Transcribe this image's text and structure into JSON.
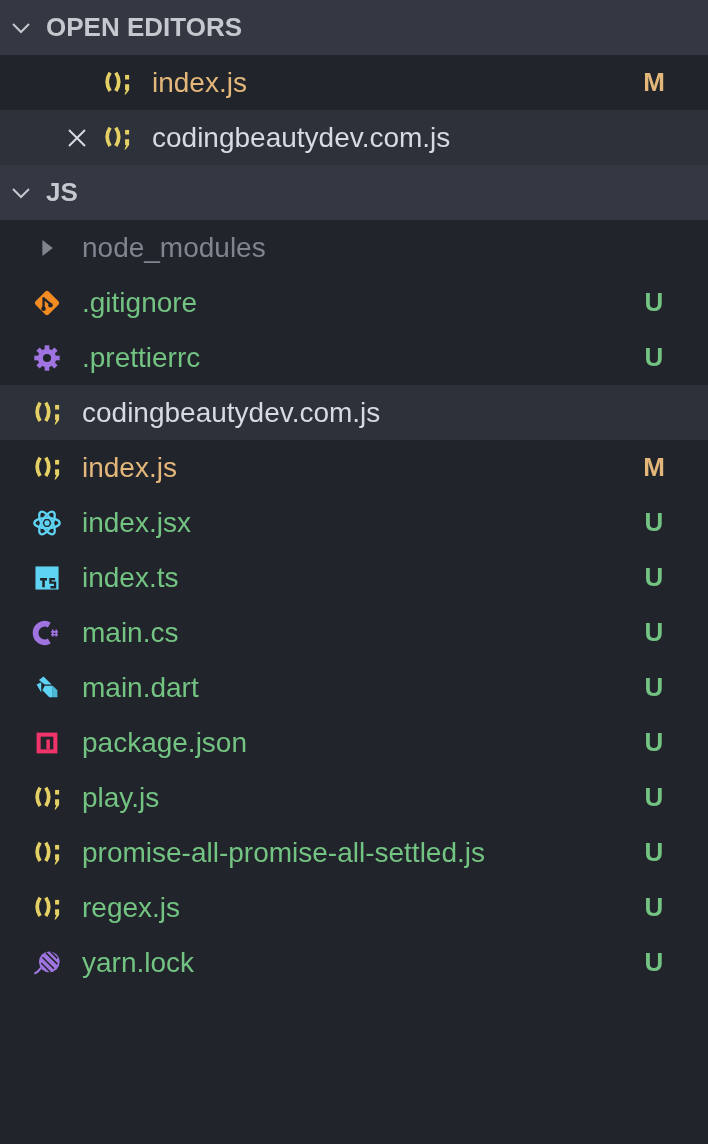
{
  "sections": [
    {
      "title": "OPEN EDITORS",
      "expanded": true,
      "kind": "editors",
      "items": [
        {
          "label": "index.js",
          "kind": "js",
          "color": "#e3b67a",
          "status": "M",
          "hovered": false,
          "close": false
        },
        {
          "label": "codingbeautydev.com.js",
          "kind": "js",
          "color": "#d7dae0",
          "hovered": true,
          "close": true
        }
      ]
    },
    {
      "title": "JS",
      "expanded": true,
      "kind": "tree",
      "items": [
        {
          "label": "node_modules",
          "kind": "folder",
          "color": "#7f848e",
          "expanded": false,
          "hovered": false
        },
        {
          "label": ".gitignore",
          "kind": "git",
          "color": "#73c382",
          "status": "U",
          "hovered": false
        },
        {
          "label": ".prettierrc",
          "kind": "gear",
          "color": "#73c382",
          "status": "U",
          "hovered": false
        },
        {
          "label": "codingbeautydev.com.js",
          "kind": "js",
          "color": "#d7dae0",
          "hovered": true
        },
        {
          "label": "index.js",
          "kind": "js",
          "color": "#e3b67a",
          "status": "M",
          "hovered": false
        },
        {
          "label": "index.jsx",
          "kind": "react",
          "color": "#73c382",
          "status": "U",
          "hovered": false
        },
        {
          "label": "index.ts",
          "kind": "ts",
          "color": "#73c382",
          "status": "U",
          "hovered": false
        },
        {
          "label": "main.cs",
          "kind": "csharp",
          "color": "#73c382",
          "status": "U",
          "hovered": false
        },
        {
          "label": "main.dart",
          "kind": "dart",
          "color": "#73c382",
          "status": "U",
          "hovered": false
        },
        {
          "label": "package.json",
          "kind": "npm",
          "color": "#73c382",
          "status": "U",
          "hovered": false
        },
        {
          "label": "play.js",
          "kind": "js",
          "color": "#73c382",
          "status": "U",
          "hovered": false
        },
        {
          "label": "promise-all-promise-all-settled.js",
          "kind": "js",
          "color": "#73c382",
          "status": "U",
          "hovered": false
        },
        {
          "label": "regex.js",
          "kind": "js",
          "color": "#73c382",
          "status": "U",
          "hovered": false
        },
        {
          "label": "yarn.lock",
          "kind": "yarn",
          "color": "#73c382",
          "status": "U",
          "hovered": false
        }
      ]
    }
  ]
}
